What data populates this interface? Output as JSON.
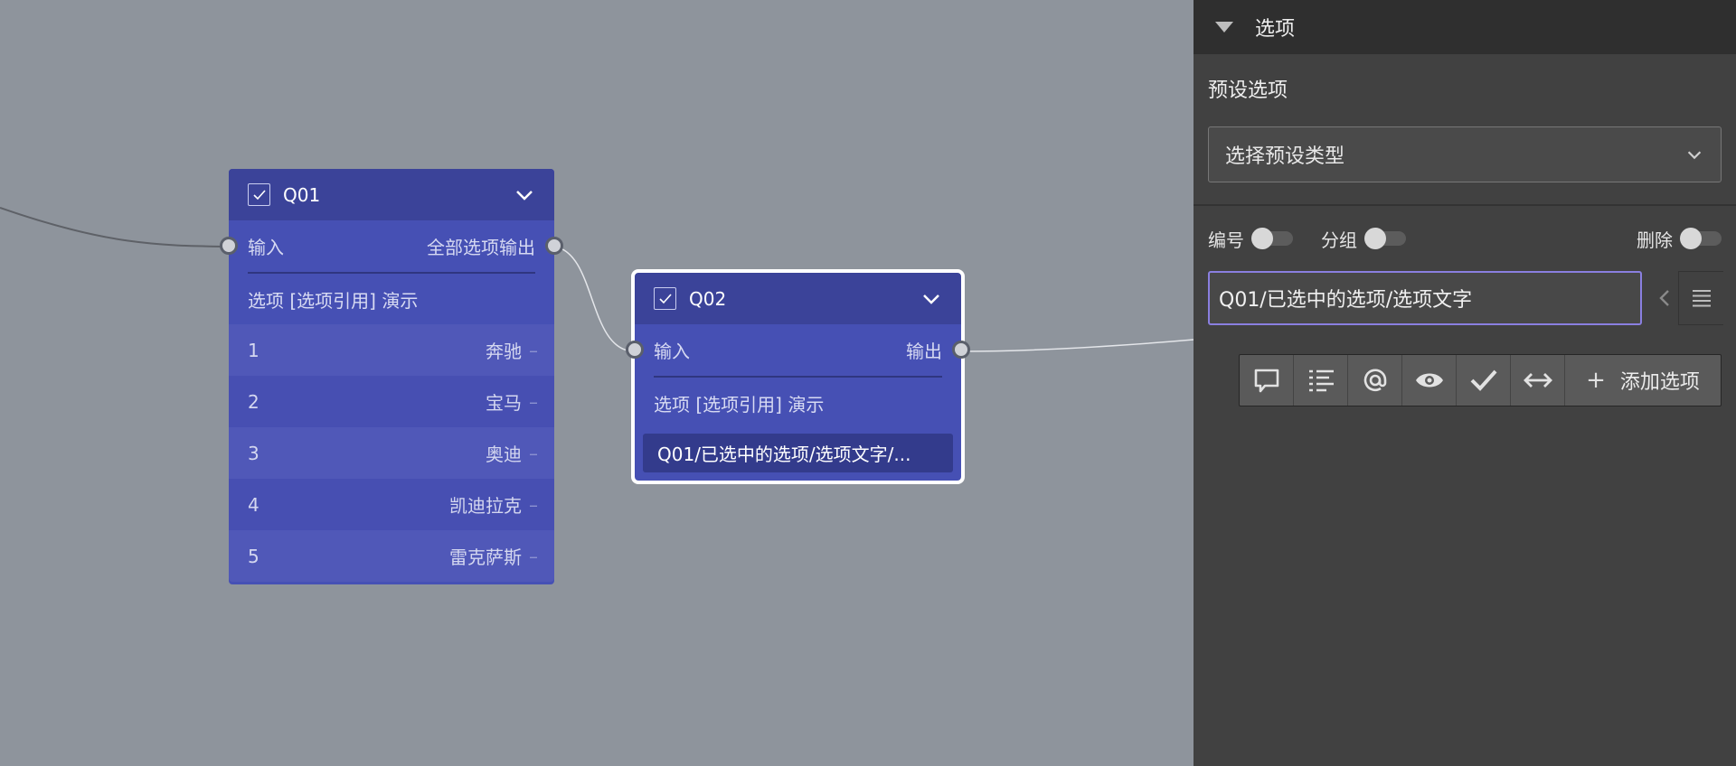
{
  "node_q01": {
    "title": "Q01",
    "input_label": "输入",
    "output_label": "全部选项输出",
    "subtitle": "选项 [选项引用] 演示",
    "options": [
      {
        "index": "1",
        "label": "奔驰"
      },
      {
        "index": "2",
        "label": "宝马"
      },
      {
        "index": "3",
        "label": "奥迪"
      },
      {
        "index": "4",
        "label": "凯迪拉克"
      },
      {
        "index": "5",
        "label": "雷克萨斯"
      }
    ],
    "option_dash": "–"
  },
  "node_q02": {
    "title": "Q02",
    "input_label": "输入",
    "output_label": "输出",
    "subtitle": "选项 [选项引用] 演示",
    "ref_chip": "Q01/已选中的选项/选项文字/..."
  },
  "panel": {
    "header": "选项",
    "preset_label": "预设选项",
    "preset_select": "选择预设类型",
    "toggle_number": "编号",
    "toggle_group": "分组",
    "toggle_delete": "删除",
    "ref_input_value": "Q01/已选中的选项/选项文字",
    "add_option": "添加选项"
  },
  "colors": {
    "canvas_bg": "#8e949c",
    "node_bg": "#4650b4",
    "node_header": "#3b4399",
    "panel_bg": "#414141",
    "input_border": "#8a7fe0"
  }
}
